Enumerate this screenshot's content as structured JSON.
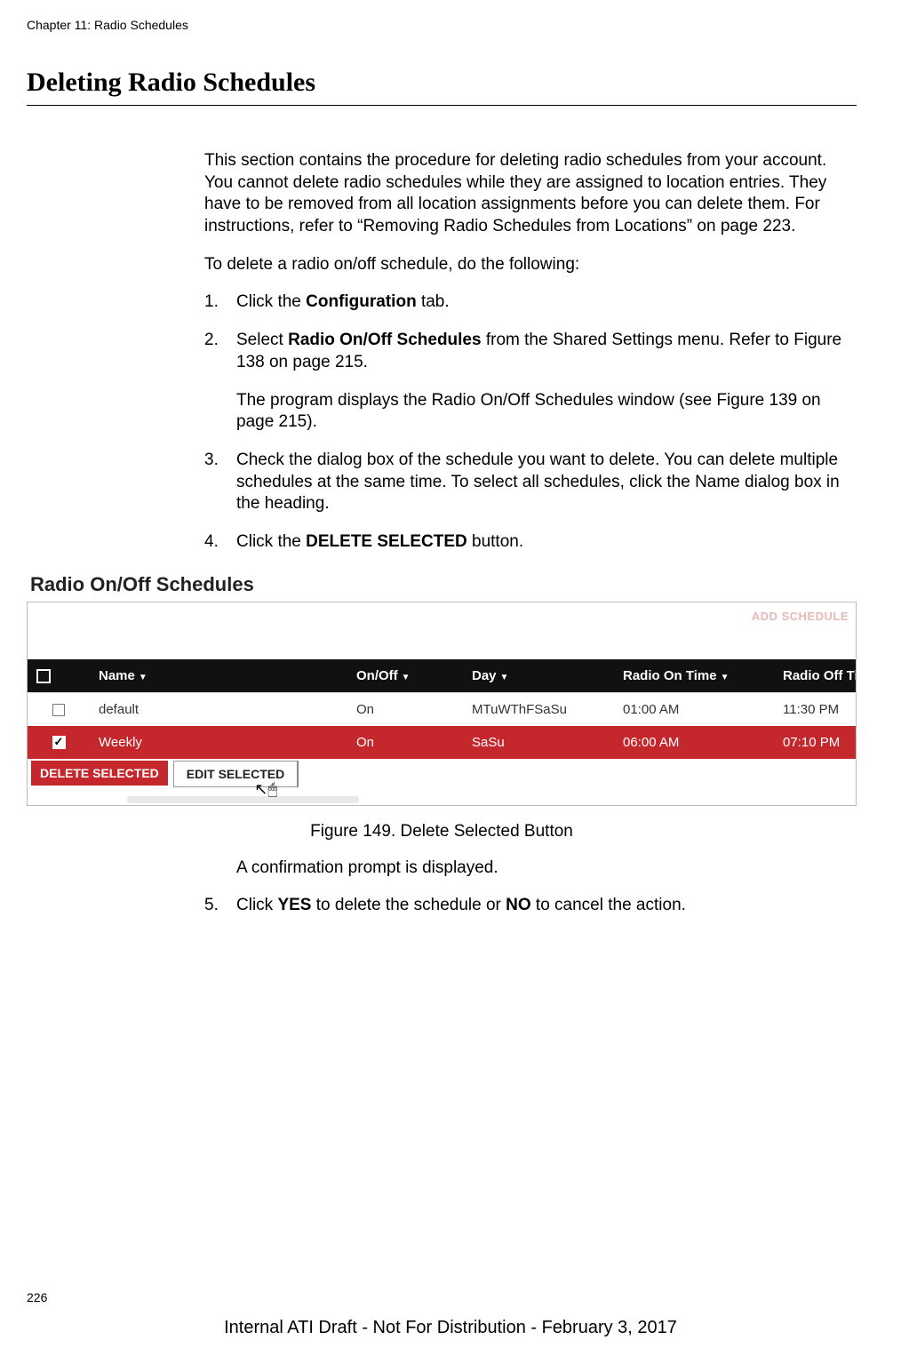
{
  "doc": {
    "chapter": "Chapter 11: Radio Schedules",
    "section_title": "Deleting Radio Schedules",
    "intro": "This section contains the procedure for deleting radio schedules from your account. You cannot delete radio schedules while they are assigned to location entries. They have to be removed from all location assignments before you can delete them. For instructions, refer to “Removing Radio Schedules from Locations” on page 223.",
    "lead": "To delete a radio on/off schedule, do the following:",
    "step1_pre": "Click the ",
    "step1_bold": "Configuration",
    "step1_post": " tab.",
    "step2_pre": "Select ",
    "step2_bold": "Radio On/Off Schedules",
    "step2_post": " from the Shared Settings menu. Refer to Figure 138 on page 215.",
    "step2_sub": "The program displays the Radio On/Off Schedules window (see Figure 139 on page 215).",
    "step3": "Check the dialog box of the schedule you want to delete. You can delete multiple schedules at the same time. To select all schedules, click the Name dialog box in the heading.",
    "step4_pre": "Click the ",
    "step4_bold": "DELETE SELECTED",
    "step4_post": " button.",
    "confirm_para": "A confirmation prompt is displayed.",
    "step5_pre": "Click ",
    "step5_bold1": "YES",
    "step5_mid": " to delete the schedule or ",
    "step5_bold2": "NO",
    "step5_post": " to cancel the action.",
    "figure_caption": "Figure 149. Delete Selected Button",
    "page_number": "226",
    "footer": "Internal ATI Draft - Not For Distribution - February 3, 2017"
  },
  "screenshot": {
    "title": "Radio On/Off Schedules",
    "add_button": "ADD SCHEDULE",
    "headers": {
      "name": "Name",
      "onoff": "On/Off",
      "day": "Day",
      "ontime": "Radio On Time",
      "offtime": "Radio Off Time"
    },
    "rows": [
      {
        "checked": false,
        "name": "default",
        "onoff": "On",
        "day": "MTuWThFSaSu",
        "ontime": "01:00 AM",
        "offtime": "11:30 PM"
      },
      {
        "checked": true,
        "name": "Weekly",
        "onoff": "On",
        "day": "SaSu",
        "ontime": "06:00 AM",
        "offtime": "07:10 PM"
      }
    ],
    "buttons": {
      "delete": "DELETE SELECTED",
      "edit": "EDIT SELECTED"
    }
  }
}
